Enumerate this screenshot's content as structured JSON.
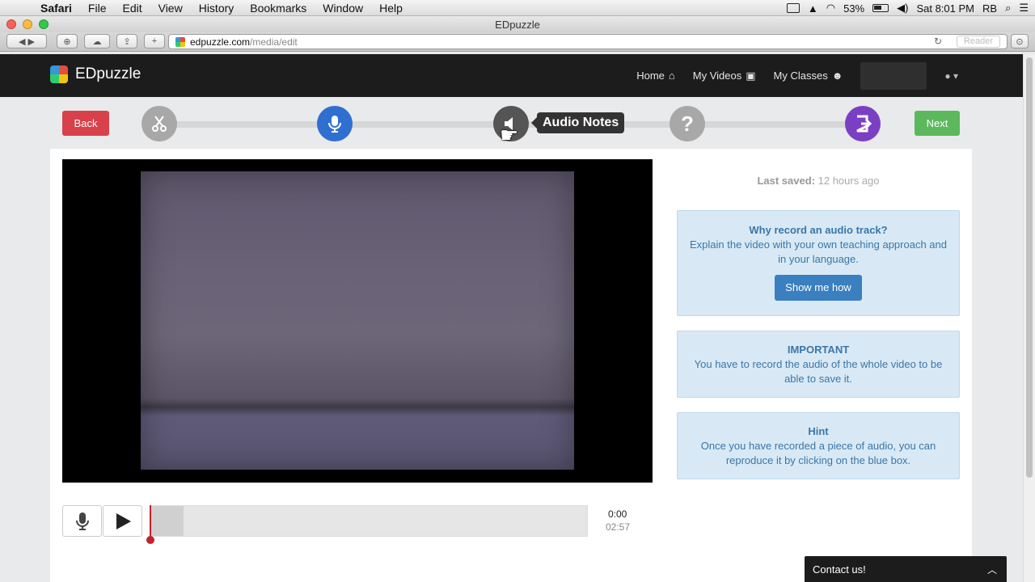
{
  "menubar": {
    "items": [
      "Safari",
      "File",
      "Edit",
      "View",
      "History",
      "Bookmarks",
      "Window",
      "Help"
    ],
    "battery": "53%",
    "clock": "Sat 8:01 PM",
    "user": "RB"
  },
  "window": {
    "title": "EDpuzzle"
  },
  "browser": {
    "url_host": "edpuzzle.com",
    "url_path": "/media/edit",
    "reader_label": "Reader"
  },
  "nav": {
    "brand": "EDpuzzle",
    "links": [
      {
        "label": "Home",
        "icon": "home-icon"
      },
      {
        "label": "My Videos",
        "icon": "video-icon"
      },
      {
        "label": "My Classes",
        "icon": "users-icon"
      }
    ]
  },
  "steps": {
    "back_label": "Back",
    "next_label": "Next",
    "tooltip": "Audio Notes",
    "items": [
      {
        "name": "cut",
        "icon": "scissors-icon",
        "color": "#a8a8a8"
      },
      {
        "name": "voiceover",
        "icon": "microphone-icon",
        "color": "#2f6fd0"
      },
      {
        "name": "audio-notes",
        "icon": "speaker-icon",
        "color": "#555555"
      },
      {
        "name": "quiz",
        "icon": "question-icon",
        "color": "#a8a8a8"
      },
      {
        "name": "finish",
        "icon": "exit-icon",
        "color": "#7b3fc4"
      }
    ]
  },
  "sidebar": {
    "saved_label": "Last saved:",
    "saved_value": "12 hours ago",
    "boxes": [
      {
        "title": "Why record an audio track?",
        "body": "Explain the video with your own teaching approach and in your language.",
        "button": "Show me how"
      },
      {
        "title": "IMPORTANT",
        "body": "You have to record the audio of the whole video to be able to save it."
      },
      {
        "title": "Hint",
        "body": "Once you have recorded a piece of audio, you can reproduce it by clicking on the blue box."
      }
    ]
  },
  "player": {
    "current_time": "0:00",
    "total_time": "02:57"
  },
  "contact": {
    "label": "Contact us!"
  },
  "colors": {
    "back": "#d9414a",
    "next": "#5cb85c",
    "info_bg": "#d8e9f5",
    "info_text": "#3b76a8",
    "nav_bg": "#1c1c1c"
  }
}
